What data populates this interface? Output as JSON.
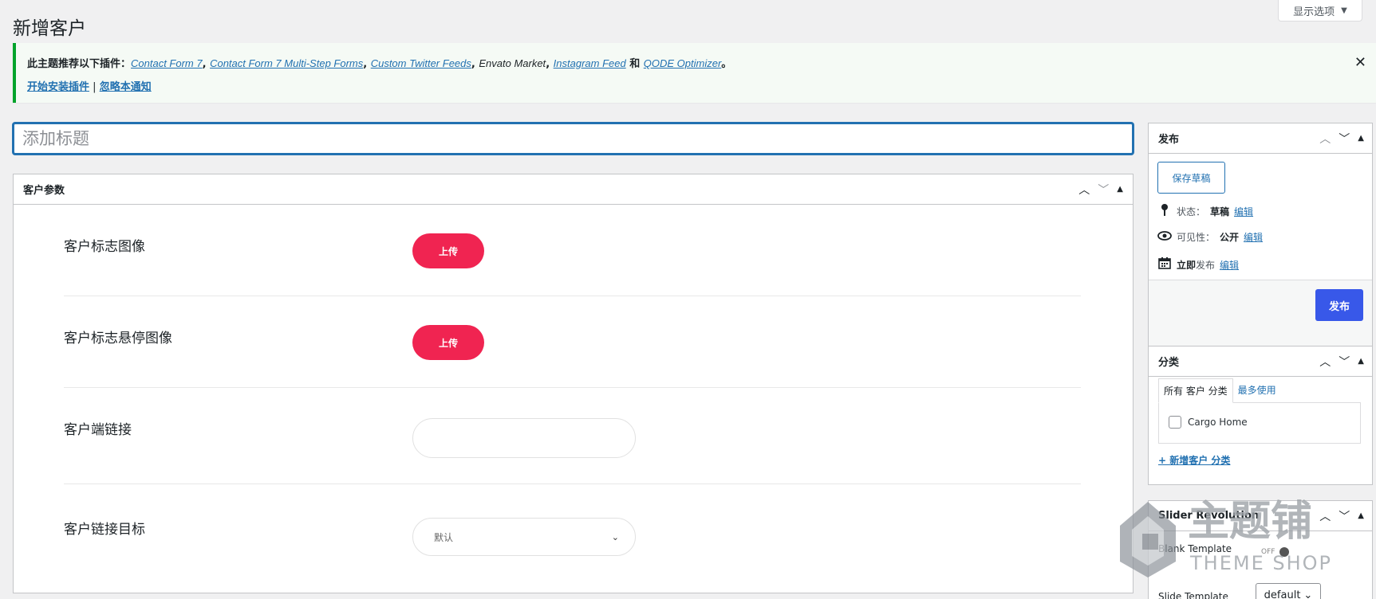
{
  "screen_options": {
    "label": "显示选项",
    "caret": "▼"
  },
  "page_title": "新增客户",
  "notice": {
    "prefix": "此主题推荐以下插件：",
    "plugins": [
      "Contact Form 7",
      "Contact Form 7 Multi-Step Forms",
      "Custom Twitter Feeds",
      "Envato Market",
      "Instagram Feed",
      "QODE Optimizer"
    ],
    "and": "和",
    "period": "。",
    "install_link": "开始安装插件",
    "separator": "|",
    "dismiss_link": "忽略本通知",
    "close": "✕"
  },
  "title_placeholder": "添加标题",
  "client_box": {
    "title": "客户参数",
    "fields": {
      "logo_label": "客户标志图像",
      "logo_button": "上传",
      "hover_label": "客户标志悬停图像",
      "hover_button": "上传",
      "link_label": "客户端链接",
      "link_value": "",
      "target_label": "客户链接目标",
      "target_value": "默认"
    }
  },
  "publish_box": {
    "title": "发布",
    "save_draft": "保存草稿",
    "status_label": "状态：",
    "status_value": "草稿",
    "visibility_label": "可见性：",
    "visibility_value": "公开",
    "schedule_bold": "立即",
    "schedule_label": "发布",
    "edit": "编辑",
    "publish_button": "发布"
  },
  "category_box": {
    "title": "分类",
    "tab_all": "所有 客户 分类",
    "tab_popular": "最多使用",
    "items": [
      "Cargo Home"
    ],
    "add_new": "+ 新增客户 分类"
  },
  "slider_box": {
    "title": "Slider Revolution",
    "blank_template": "Blank Template",
    "toggle": "OFF",
    "slide_template": "Slide Template",
    "template_value": "default"
  },
  "watermark": {
    "text_cn": "主题铺",
    "text_en": "THEME SHOP"
  },
  "colors": {
    "accent": "#2271b1",
    "upload": "#f02451",
    "publish": "#3858e9",
    "notice_border": "#00a32a"
  }
}
